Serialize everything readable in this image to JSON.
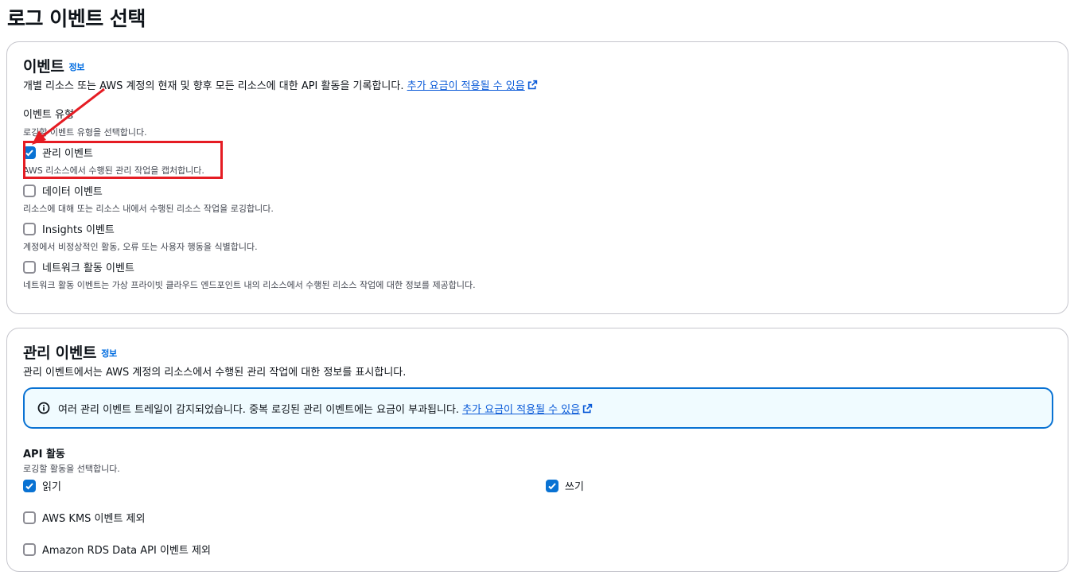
{
  "page": {
    "title": "로그 이벤트 선택"
  },
  "events_panel": {
    "heading": "이벤트",
    "info": "정보",
    "description": "개별 리소스 또는 AWS 계정의 현재 및 향후 모든 리소스에 대한 API 활동을 기록합니다.",
    "charges_link": "추가 요금이 적용될 수 있음",
    "event_type_label": "이벤트 유형",
    "event_type_hint": "로깅할 이벤트 유형을 선택합니다.",
    "options": [
      {
        "label": "관리 이벤트",
        "checked": true,
        "description": "AWS 리소스에서 수행된 관리 작업을 캡처합니다."
      },
      {
        "label": "데이터 이벤트",
        "checked": false,
        "description": "리소스에 대해 또는 리소스 내에서 수행된 리소스 작업을 로깅합니다."
      },
      {
        "label": "Insights 이벤트",
        "checked": false,
        "description": "계정에서 비정상적인 활동, 오류 또는 사용자 행동을 식별합니다."
      },
      {
        "label": "네트워크 활동 이벤트",
        "checked": false,
        "description": "네트워크 활동 이벤트는 가상 프라이빗 클라우드 엔드포인트 내의 리소스에서 수행된 리소스 작업에 대한 정보를 제공합니다."
      }
    ]
  },
  "management_panel": {
    "heading": "관리 이벤트",
    "info": "정보",
    "description": "관리 이벤트에서는 AWS 계정의 리소스에서 수행된 관리 작업에 대한 정보를 표시합니다.",
    "alert_text": "여러 관리 이벤트 트레일이 감지되었습니다. 중복 로깅된 관리 이벤트에는 요금이 부과됩니다.",
    "alert_link": "추가 요금이 적용될 수 있음",
    "api_activity_label": "API 활동",
    "api_activity_hint": "로깅할 활동을 선택합니다.",
    "read": {
      "label": "읽기",
      "checked": true
    },
    "write": {
      "label": "쓰기",
      "checked": true
    },
    "exclude_kms": {
      "label": "AWS KMS 이벤트 제외",
      "checked": false
    },
    "exclude_rds": {
      "label": "Amazon RDS Data API 이벤트 제외",
      "checked": false
    }
  },
  "colors": {
    "accent": "#0972d3",
    "link": "#0a5ad8",
    "annotation": "#e51c23",
    "alert_bg": "#f0fbff"
  }
}
